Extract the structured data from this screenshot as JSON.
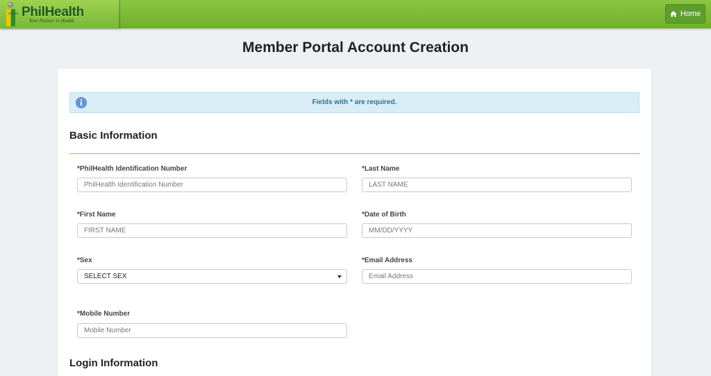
{
  "header": {
    "logo_name": "PhilHealth",
    "logo_tagline": "Your Partner in Health",
    "home_label": "Home"
  },
  "page": {
    "title": "Member Portal Account Creation"
  },
  "notice": {
    "text": "Fields with * are required."
  },
  "basic_information": {
    "title": "Basic Information",
    "pin": {
      "label": "*PhilHealth Identification Number",
      "placeholder": "PhilHealth Identification Number",
      "value": ""
    },
    "last_name": {
      "label": "*Last Name",
      "placeholder": "LAST NAME",
      "value": ""
    },
    "first_name": {
      "label": "*First Name",
      "placeholder": "FIRST NAME",
      "value": ""
    },
    "dob": {
      "label": "*Date of Birth",
      "placeholder": "MM/DD/YYYY",
      "value": ""
    },
    "sex": {
      "label": "*Sex",
      "selected": "SELECT SEX"
    },
    "email": {
      "label": "*Email Address",
      "placeholder": "Email Address",
      "value": ""
    },
    "mobile": {
      "label": "*Mobile Number",
      "placeholder": "Mobile Number",
      "value": ""
    }
  },
  "login_information": {
    "title": "Login Information"
  },
  "colors": {
    "brand_green": "#8cc63f",
    "header_green_dark": "#6fae2d",
    "logo_text": "#1d5a1a",
    "info_bg": "#d9edf7",
    "info_text": "#31708f"
  },
  "icons": {
    "home": "home-icon",
    "info": "info-icon",
    "dropdown": "caret-down-icon"
  }
}
